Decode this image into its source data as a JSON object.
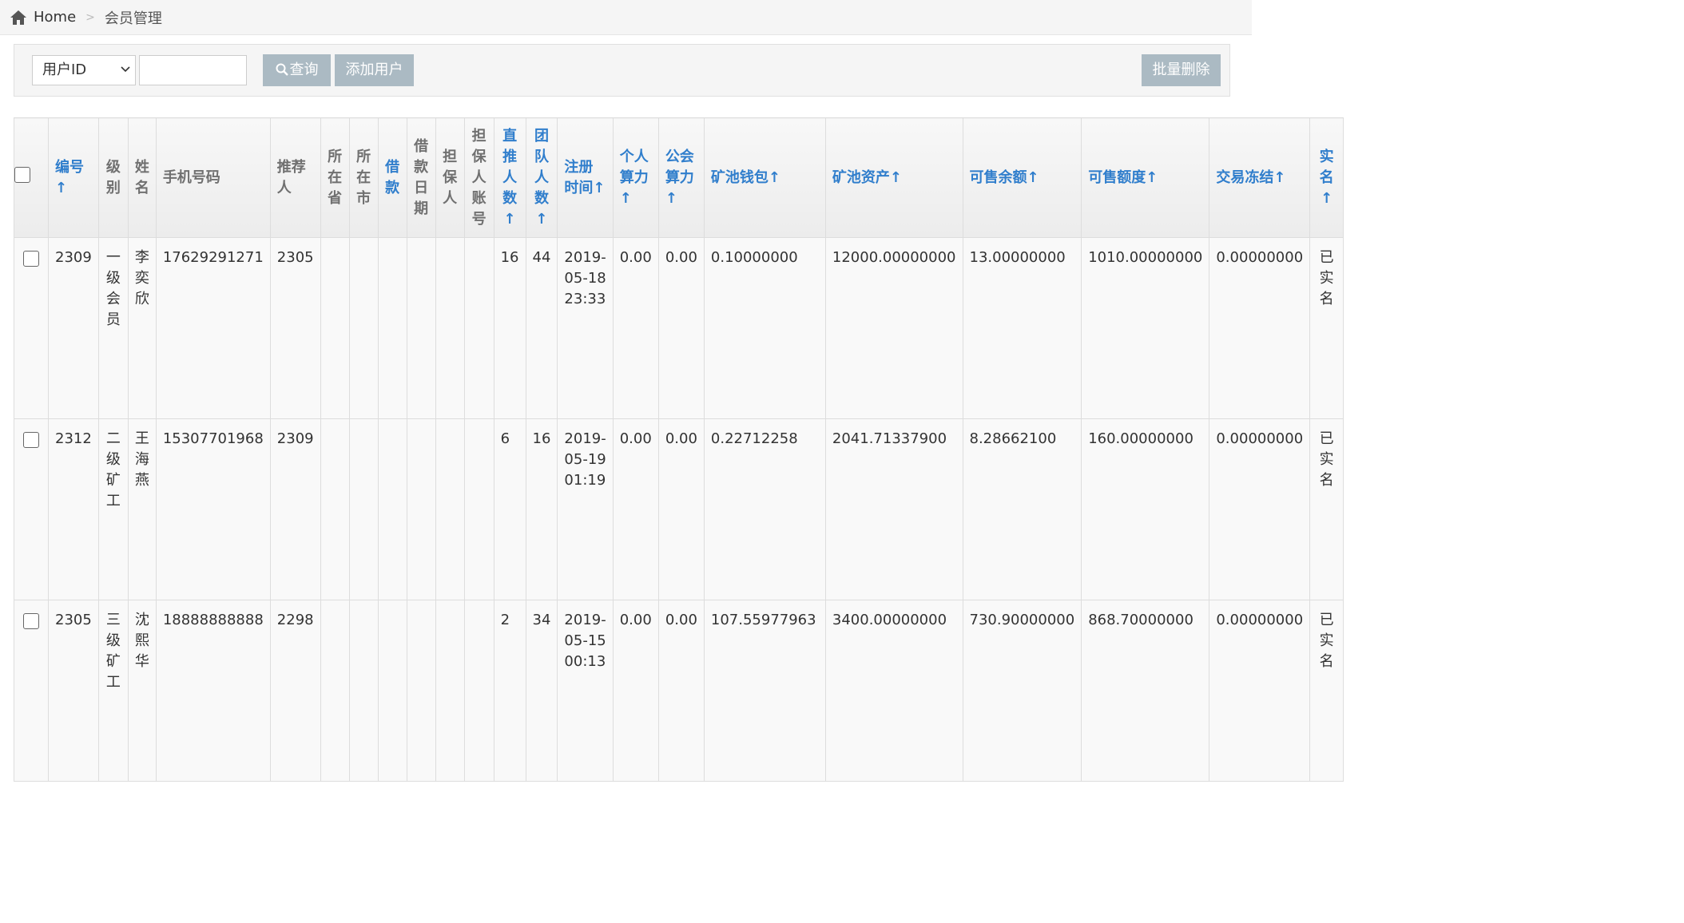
{
  "breadcrumb": {
    "home": "Home",
    "current": "会员管理"
  },
  "toolbar": {
    "select_value": "用户ID",
    "search_value": "",
    "search_label": "查询",
    "add_label": "添加用户",
    "batch_delete_label": "批量删除"
  },
  "table": {
    "headers": {
      "id": "编号↑",
      "level": "级别",
      "name": "姓名",
      "phone": "手机号码",
      "referrer": "推荐人",
      "province": "所在省",
      "city": "所在市",
      "loan": "借款",
      "loan_date": "借款日期",
      "guarantor": "担保人",
      "guarantor_account": "担保人账号",
      "direct_count": "直推人数↑",
      "team_count": "团队人数↑",
      "reg_time": "注册时间↑",
      "personal_power": "个人算力↑",
      "guild_power": "公会算力↑",
      "pool_wallet": "矿池钱包↑",
      "pool_assets": "矿池资产↑",
      "sellable_balance": "可售余额↑",
      "sellable_limit": "可售额度↑",
      "trade_frozen": "交易冻结↑",
      "verified": "实名↑"
    },
    "rows": [
      {
        "id": "2309",
        "level": "一级会员",
        "name": "李奕欣",
        "phone": "17629291271",
        "referrer": "2305",
        "province": "",
        "city": "",
        "loan": "",
        "loan_date": "",
        "guarantor": "",
        "guarantor_account": "",
        "direct_count": "16",
        "team_count": "44",
        "reg_time": "2019-05-18 23:33",
        "personal_power": "0.00",
        "guild_power": "0.00",
        "pool_wallet": "0.10000000",
        "pool_assets": "12000.00000000",
        "sellable_balance": "13.00000000",
        "sellable_limit": "1010.00000000",
        "trade_frozen": "0.00000000",
        "verified": "已实名"
      },
      {
        "id": "2312",
        "level": "二级矿工",
        "name": "王海燕",
        "phone": "15307701968",
        "referrer": "2309",
        "province": "",
        "city": "",
        "loan": "",
        "loan_date": "",
        "guarantor": "",
        "guarantor_account": "",
        "direct_count": "6",
        "team_count": "16",
        "reg_time": "2019-05-19 01:19",
        "personal_power": "0.00",
        "guild_power": "0.00",
        "pool_wallet": "0.22712258",
        "pool_assets": "2041.71337900",
        "sellable_balance": "8.28662100",
        "sellable_limit": "160.00000000",
        "trade_frozen": "0.00000000",
        "verified": "已实名"
      },
      {
        "id": "2305",
        "level": "三级矿工",
        "name": "沈熙华",
        "phone": "18888888888",
        "referrer": "2298",
        "province": "",
        "city": "",
        "loan": "",
        "loan_date": "",
        "guarantor": "",
        "guarantor_account": "",
        "direct_count": "2",
        "team_count": "34",
        "reg_time": "2019-05-15 00:13",
        "personal_power": "0.00",
        "guild_power": "0.00",
        "pool_wallet": "107.55977963",
        "pool_assets": "3400.00000000",
        "sellable_balance": "730.90000000",
        "sellable_limit": "868.70000000",
        "trade_frozen": "0.00000000",
        "verified": "已实名"
      }
    ]
  }
}
